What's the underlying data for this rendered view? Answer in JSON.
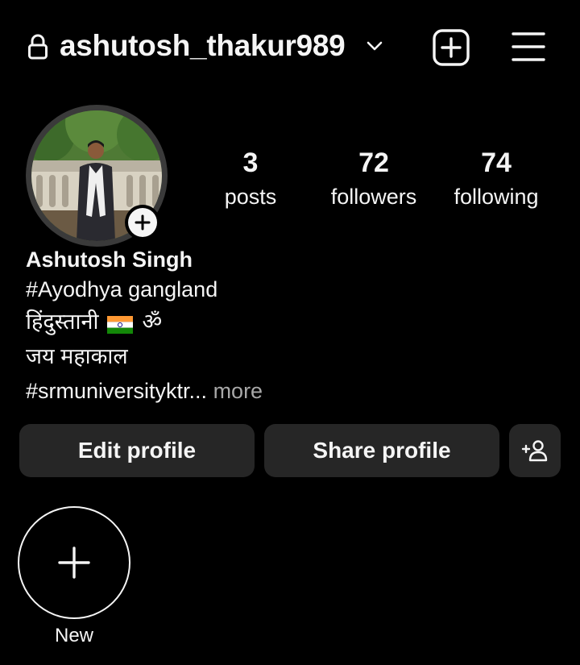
{
  "header": {
    "username": "ashutosh_thakur989",
    "lock_icon": "lock-icon",
    "chevron_icon": "chevron-down-icon",
    "add_icon": "plus-square-icon",
    "menu_icon": "hamburger-menu-icon"
  },
  "profile": {
    "avatar_add_icon": "plus-icon",
    "stats": {
      "posts": {
        "value": "3",
        "label": "posts"
      },
      "followers": {
        "value": "72",
        "label": "followers"
      },
      "following": {
        "value": "74",
        "label": "following"
      }
    },
    "name": "Ashutosh Singh",
    "bio": {
      "line1": "#Ayodhya gangland",
      "line2": "हिंदुस्तानी",
      "line2_om": "ॐ",
      "line3": "जय महाकाल",
      "line4": "#srmuniversityktr...",
      "more": "more"
    }
  },
  "buttons": {
    "edit": "Edit profile",
    "share": "Share profile",
    "discover_icon": "add-person-icon"
  },
  "highlights": {
    "new_label": "New"
  },
  "colors": {
    "background": "#000000",
    "text": "#f5f5f5",
    "button_bg": "#262626",
    "muted": "#a8a8a8"
  }
}
